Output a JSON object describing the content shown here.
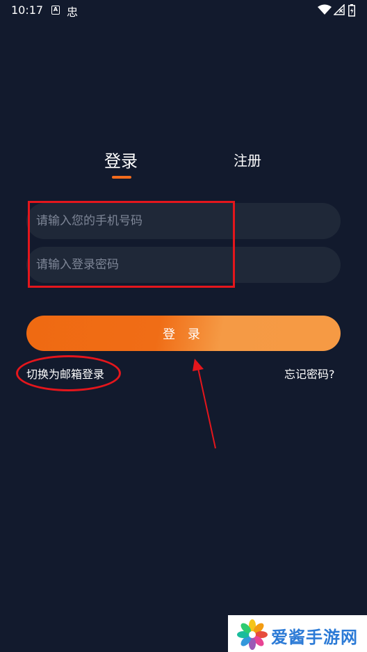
{
  "status_bar": {
    "time": "10:17",
    "a_badge": "A",
    "app_glyph": "忠"
  },
  "tabs": [
    {
      "label": "登录",
      "active": true
    },
    {
      "label": "注册",
      "active": false
    }
  ],
  "form": {
    "phone_placeholder": "请输入您的手机号码",
    "password_placeholder": "请输入登录密码",
    "login_label": "登 录"
  },
  "links": {
    "switch_email": "切换为邮箱登录",
    "forgot_password": "忘记密码?"
  },
  "watermark": {
    "text": "爱酱手游网"
  },
  "colors": {
    "background": "#121a2d",
    "accent": "#f26b1d",
    "annotation": "#e4161c",
    "input_bg": "#1f2838"
  }
}
